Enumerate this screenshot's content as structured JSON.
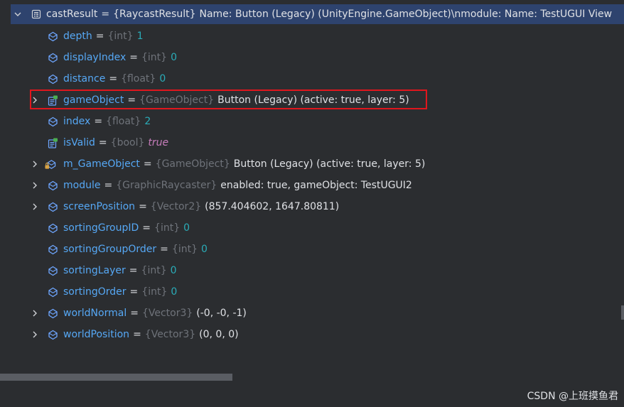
{
  "root": {
    "name": "castResult",
    "type": "{RaycastResult}",
    "value": "Name: Button (Legacy) (UnityEngine.GameObject)\\nmodule: Name: TestUGUI View"
  },
  "fields": [
    {
      "name": "depth",
      "type": "{int}",
      "value": "1",
      "value_kind": "num",
      "expandable": false,
      "icon": "field-icon"
    },
    {
      "name": "displayIndex",
      "type": "{int}",
      "value": "0",
      "value_kind": "num",
      "expandable": false,
      "icon": "field-icon"
    },
    {
      "name": "distance",
      "type": "{float}",
      "value": "0",
      "value_kind": "num",
      "expandable": false,
      "icon": "field-icon"
    },
    {
      "name": "gameObject",
      "type": "{GameObject}",
      "value": "Button (Legacy) (active: true, layer: 5)",
      "value_kind": "text",
      "expandable": true,
      "icon": "property-icon"
    },
    {
      "name": "index",
      "type": "{float}",
      "value": "2",
      "value_kind": "num",
      "expandable": false,
      "icon": "field-icon"
    },
    {
      "name": "isValid",
      "type": "{bool}",
      "value": "true",
      "value_kind": "kw",
      "expandable": false,
      "icon": "property-icon"
    },
    {
      "name": "m_GameObject",
      "type": "{GameObject}",
      "value": "Button (Legacy) (active: true, layer: 5)",
      "value_kind": "text",
      "expandable": true,
      "icon": "private-field-icon"
    },
    {
      "name": "module",
      "type": "{GraphicRaycaster}",
      "value": "enabled: true, gameObject: TestUGUI2",
      "value_kind": "text",
      "expandable": true,
      "icon": "field-icon"
    },
    {
      "name": "screenPosition",
      "type": "{Vector2}",
      "value": "(857.404602, 1647.80811)",
      "value_kind": "text",
      "expandable": true,
      "icon": "field-icon"
    },
    {
      "name": "sortingGroupID",
      "type": "{int}",
      "value": "0",
      "value_kind": "num",
      "expandable": false,
      "icon": "field-icon"
    },
    {
      "name": "sortingGroupOrder",
      "type": "{int}",
      "value": "0",
      "value_kind": "num",
      "expandable": false,
      "icon": "field-icon"
    },
    {
      "name": "sortingLayer",
      "type": "{int}",
      "value": "0",
      "value_kind": "num",
      "expandable": false,
      "icon": "field-icon"
    },
    {
      "name": "sortingOrder",
      "type": "{int}",
      "value": "0",
      "value_kind": "num",
      "expandable": false,
      "icon": "field-icon"
    },
    {
      "name": "worldNormal",
      "type": "{Vector3}",
      "value": "(-0, -0, -1)",
      "value_kind": "text",
      "expandable": true,
      "icon": "field-icon"
    },
    {
      "name": "worldPosition",
      "type": "{Vector3}",
      "value": "(0, 0, 0)",
      "value_kind": "text",
      "expandable": true,
      "icon": "field-icon"
    }
  ],
  "highlighted_field": "gameObject",
  "watermark": "CSDN @上班摸鱼君",
  "colors": {
    "background": "#2b2d30",
    "selected_row": "#2e436e",
    "field_name": "#56a8f5",
    "type_hint": "#6f737a",
    "number": "#2aacb8",
    "keyword": "#c77dbb",
    "highlight_border": "#e0161d"
  }
}
